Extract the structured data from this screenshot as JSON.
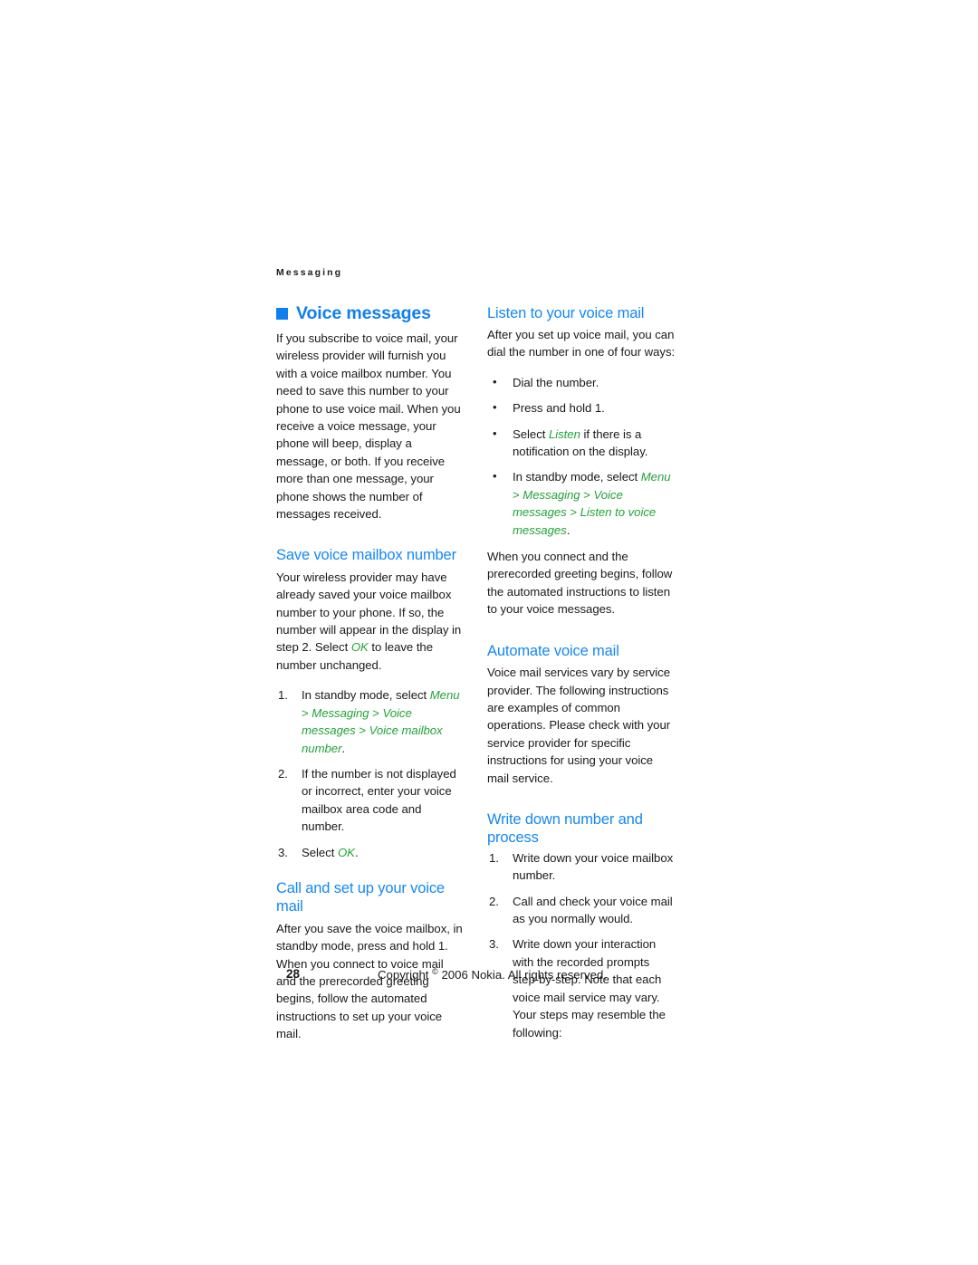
{
  "document": {
    "running_head": "Messaging",
    "page_number": "28",
    "copyright": "Copyright © 2006 Nokia. All rights reserved.",
    "copyright_prefix": "Copyright",
    "copyright_symbol": "©",
    "copyright_suffix": "2006 Nokia. All rights reserved."
  },
  "colors": {
    "heading_blue": "#1488f5",
    "title_blue": "#0f7ff0",
    "menu_green": "#22a33a",
    "body_text": "#1a1a1a",
    "page_background": "#ffffff"
  },
  "left_column": {
    "chapter_title": "Voice messages",
    "intro_paragraph": "If you subscribe to voice mail, your wireless provider will furnish you with a voice mailbox number. You need to save this number to your phone to use voice mail. When you receive a voice message, your phone will beep, display a message, or both. If you receive more than one message, your phone shows the number of messages received.",
    "save_section": {
      "heading": "Save voice mailbox number",
      "paragraph_part1": "Your wireless provider may have already saved your voice mailbox number to your phone. If so, the number will appear in the display in step 2. Select ",
      "paragraph_menu": "OK",
      "paragraph_part2": " to leave the number unchanged.",
      "steps": [
        {
          "number": "1.",
          "text_part1": "In standby mode, select ",
          "menu_path": [
            "Menu",
            "Messaging",
            "Voice messages",
            "Voice mailbox number"
          ],
          "separator": " > ",
          "text_part2": "."
        },
        {
          "number": "2.",
          "text_part1": "If the number is not displayed or incorrect, enter your voice mailbox area code and number.",
          "menu_path": [],
          "separator": "",
          "text_part2": ""
        },
        {
          "number": "3.",
          "text_part1": "Select ",
          "menu_path": [
            "OK"
          ],
          "separator": "",
          "text_part2": "."
        }
      ]
    },
    "call_section": {
      "heading": "Call and set up your voice mail",
      "paragraph": "After you save the voice mailbox, in standby mode, press and hold 1. When you connect to voice mail and the prerecorded greeting begins, follow the automated instructions to set up your voice mail."
    }
  },
  "right_column": {
    "listen_section": {
      "heading": "Listen to your voice mail",
      "intro": "After you set up voice mail, you can dial the number in one of four ways:",
      "bullet_glyph": "•",
      "bullets": [
        {
          "text_part1": "Dial the number.",
          "menu_path": [],
          "separator": "",
          "text_part2": ""
        },
        {
          "text_part1": "Press and hold 1.",
          "menu_path": [],
          "separator": "",
          "text_part2": ""
        },
        {
          "text_part1": "Select ",
          "menu_path": [
            "Listen"
          ],
          "separator": "",
          "text_part2": " if there is a notification on the display."
        },
        {
          "text_part1": "In standby mode, select ",
          "menu_path": [
            "Menu",
            "Messaging",
            "Voice messages",
            "Listen to voice messages"
          ],
          "separator": " > ",
          "text_part2": "."
        }
      ],
      "closing_paragraph": "When you connect and the prerecorded greeting begins, follow the automated instructions to listen to your voice messages."
    },
    "automate_section": {
      "heading": "Automate voice mail",
      "paragraph": "Voice mail services vary by service provider. The following instructions are examples of common operations. Please check with your service provider for specific instructions for using your voice mail service."
    },
    "write_down_section": {
      "heading": "Write down number and process",
      "steps": [
        {
          "number": "1.",
          "text": "Write down your voice mailbox number."
        },
        {
          "number": "2.",
          "text": "Call and check your voice mail as you normally would."
        },
        {
          "number": "3.",
          "text": "Write down your interaction with the recorded prompts step-by-step. Note that each voice mail service may vary. Your steps may resemble the following:"
        }
      ]
    }
  }
}
